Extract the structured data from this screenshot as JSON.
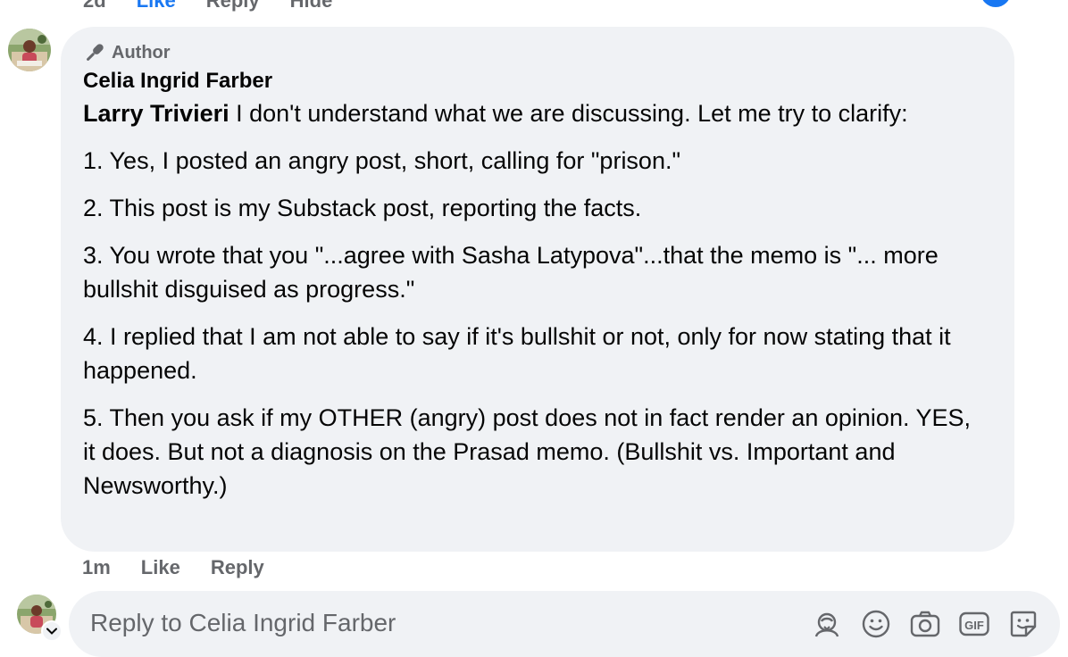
{
  "previous_comment": {
    "actions": [
      "2d",
      "Like",
      "Reply",
      "Hide"
    ]
  },
  "comment": {
    "badge": "Author",
    "author": "Celia Ingrid Farber",
    "mention": "Larry Trivieri",
    "intro": " I don't understand what we are discussing. Let me try to clarify:",
    "points": [
      "1. Yes, I posted an angry post, short, calling for \"prison.\"",
      "2. This post is my Substack post, reporting the facts.",
      "3. You wrote that you \"...agree with Sasha Latypova\"...that the memo is \"... more bullshit disguised as progress.\"",
      "4. I replied that I am not able to say if it's bullshit or not, only for now stating that it happened.",
      "5. Then you ask if my OTHER (angry) post does not in fact render an opinion. YES, it does. But not a diagnosis on the Prasad memo. (Bullshit vs. Important and Newsworthy.)"
    ],
    "time": "1m",
    "like_label": "Like",
    "reply_label": "Reply"
  },
  "reply_box": {
    "placeholder": "Reply to Celia Ingrid Farber",
    "icons": [
      "avatar-sticker-icon",
      "emoji-icon",
      "camera-icon",
      "gif-icon",
      "sticker-icon"
    ]
  },
  "colors": {
    "bubble": "#f0f2f5",
    "secondary_text": "#65676b",
    "link_blue": "#1877f2"
  }
}
